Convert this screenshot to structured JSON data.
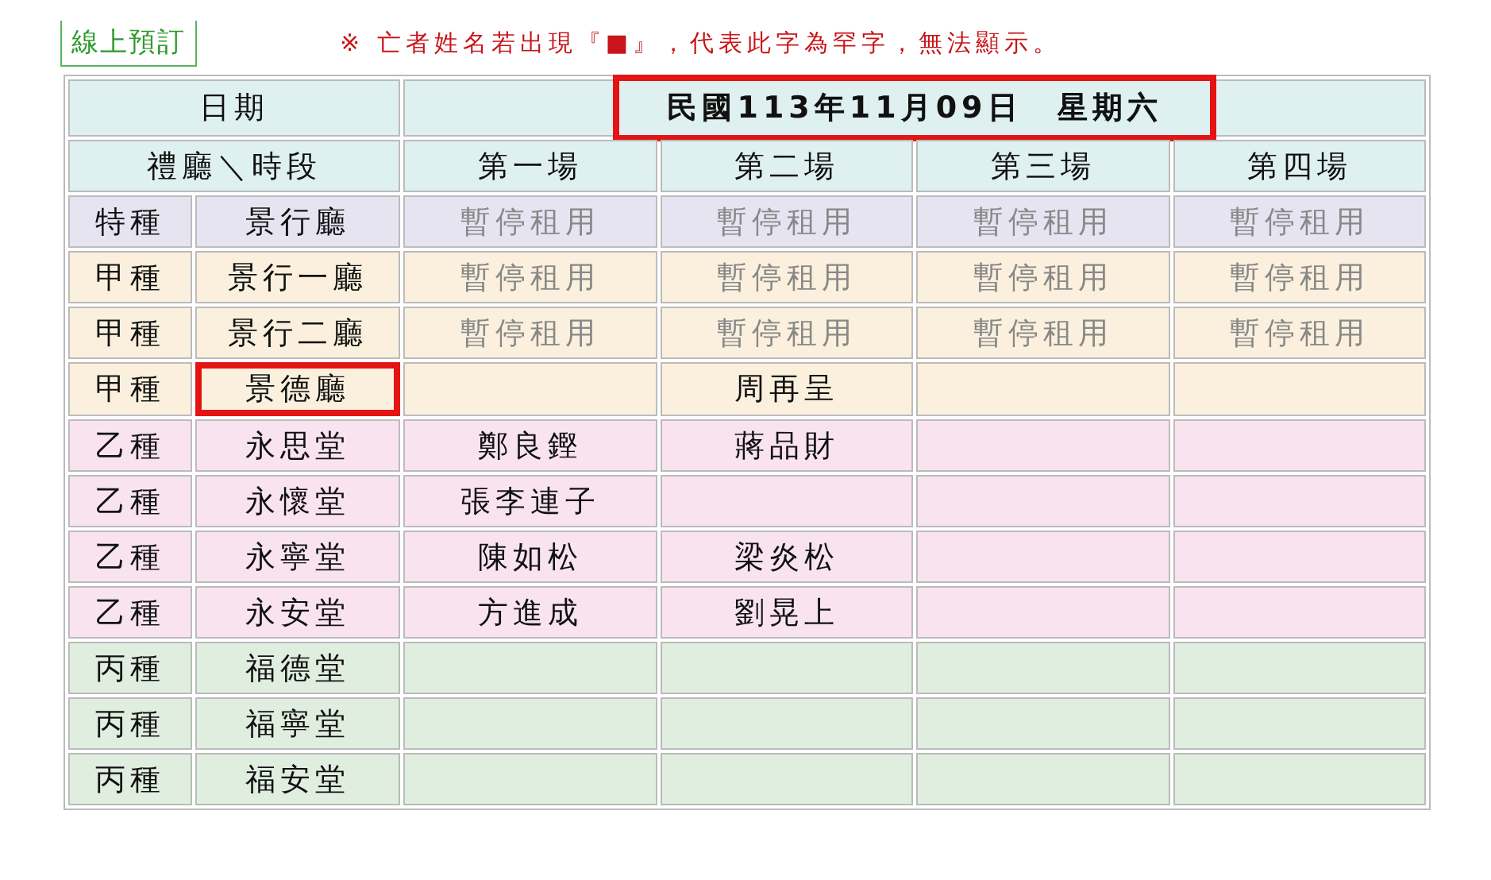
{
  "booking_link": "線上預訂",
  "notice": "※ 亡者姓名若出現『■』，代表此字為罕字，無法顯示。",
  "date_row": {
    "label": "日期",
    "value": "民國113年11月09日　星期六",
    "highlighted": true
  },
  "header_row": {
    "label": "禮廳＼時段",
    "slots": [
      "第一場",
      "第二場",
      "第三場",
      "第四場"
    ]
  },
  "rows": [
    {
      "type": "特種",
      "hall": "景行廳",
      "color": "#e7e4f2",
      "suspended": true,
      "highlighted": false,
      "slot_1": "暫停租用",
      "slot_2": "暫停租用",
      "slot_3": "暫停租用",
      "slot_4": "暫停租用"
    },
    {
      "type": "甲種",
      "hall": "景行一廳",
      "color": "#faf0dd",
      "suspended": true,
      "highlighted": false,
      "slot_1": "暫停租用",
      "slot_2": "暫停租用",
      "slot_3": "暫停租用",
      "slot_4": "暫停租用"
    },
    {
      "type": "甲種",
      "hall": "景行二廳",
      "color": "#faf0dd",
      "suspended": true,
      "highlighted": false,
      "slot_1": "暫停租用",
      "slot_2": "暫停租用",
      "slot_3": "暫停租用",
      "slot_4": "暫停租用"
    },
    {
      "type": "甲種",
      "hall": "景德廳",
      "color": "#faf0dd",
      "suspended": false,
      "highlighted": true,
      "slot_2": "周再呈"
    },
    {
      "type": "乙種",
      "hall": "永思堂",
      "color": "#f8e3ee",
      "suspended": false,
      "highlighted": false,
      "slot_1": "鄭良鏗",
      "slot_2": "蔣品財"
    },
    {
      "type": "乙種",
      "hall": "永懷堂",
      "color": "#f8e3ee",
      "suspended": false,
      "highlighted": false,
      "slot_1": "張李連子"
    },
    {
      "type": "乙種",
      "hall": "永寧堂",
      "color": "#f8e3ee",
      "suspended": false,
      "highlighted": false,
      "slot_1": "陳如松",
      "slot_2": "梁炎松"
    },
    {
      "type": "乙種",
      "hall": "永安堂",
      "color": "#f8e3ee",
      "suspended": false,
      "highlighted": false,
      "slot_1": "方進成",
      "slot_2": "劉晃上"
    },
    {
      "type": "丙種",
      "hall": "福德堂",
      "color": "#dfeedf",
      "suspended": false,
      "highlighted": false
    },
    {
      "type": "丙種",
      "hall": "福寧堂",
      "color": "#dfeedf",
      "suspended": false,
      "highlighted": false
    },
    {
      "type": "丙種",
      "hall": "福安堂",
      "color": "#dfeedf",
      "suspended": false,
      "highlighted": false
    }
  ]
}
